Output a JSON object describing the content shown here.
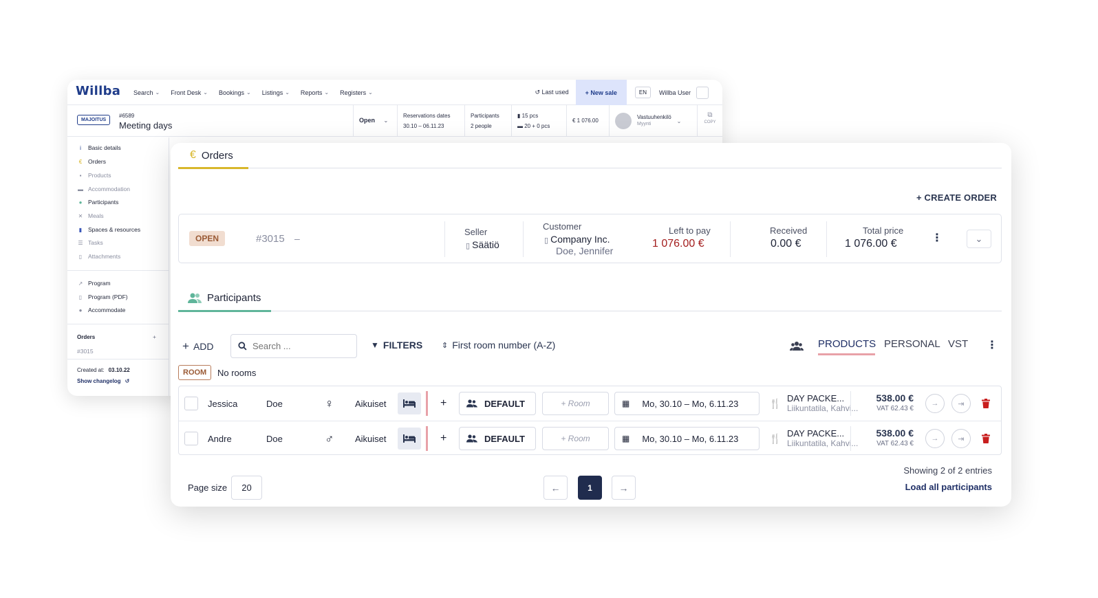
{
  "app": {
    "logo": "Willba"
  },
  "nav": {
    "menu": [
      "Search",
      "Front Desk",
      "Bookings",
      "Listings",
      "Reports",
      "Registers"
    ],
    "last_used": "Last used",
    "new_sale": "+ New sale",
    "lang": "EN",
    "user": "Willba User"
  },
  "reservation": {
    "tag": "MAJOITUS",
    "number": "#6589",
    "title": "Meeting days",
    "status": "Open",
    "dates_label": "Reservations dates",
    "dates_value": "30.10 – 06.11.23",
    "participants_label": "Participants",
    "participants_value": "2 people",
    "rooms_pcs": "15 pcs",
    "beds_pcs": "20 + 0 pcs",
    "price": "€ 1 076.00",
    "owner_name": "Vastuuhenkilö",
    "owner_role": "Myynti",
    "copy_label": "COPY"
  },
  "sidebar": {
    "items": [
      {
        "label": "Basic details",
        "icon": "i"
      },
      {
        "label": "Orders",
        "icon": "€"
      },
      {
        "label": "Products",
        "icon": "▪"
      },
      {
        "label": "Accommodation",
        "icon": "▬"
      },
      {
        "label": "Participants",
        "icon": "●"
      },
      {
        "label": "Meals",
        "icon": "✕"
      },
      {
        "label": "Spaces & resources",
        "icon": "▮"
      },
      {
        "label": "Tasks",
        "icon": "☰"
      },
      {
        "label": "Attachments",
        "icon": "▯"
      }
    ],
    "links": [
      {
        "label": "Program",
        "icon": "↗"
      },
      {
        "label": "Program (PDF)",
        "icon": "▯"
      },
      {
        "label": "Accommodate",
        "icon": "●"
      }
    ],
    "orders_title": "Orders",
    "orders_add": "+",
    "orders_item": "#3015",
    "created_label": "Created at:",
    "created_value": "03.10.22",
    "changelog": "Show changelog"
  },
  "orders_section": {
    "tab_label": "Orders",
    "create_order": "+ CREATE ORDER",
    "order": {
      "status": "OPEN",
      "id": "#3015",
      "dash": "–",
      "seller_label": "Seller",
      "seller_value": "Säätiö",
      "customer_label": "Customer",
      "customer_company": "Company Inc.",
      "customer_person": "Doe, Jennifer",
      "left_label": "Left to pay",
      "left_value": "1 076.00 €",
      "received_label": "Received",
      "received_value": "0.00 €",
      "total_label": "Total price",
      "total_value": "1 076.00 €"
    }
  },
  "participants_section": {
    "tab_label": "Participants",
    "add_label": "ADD",
    "search_placeholder": "Search ...",
    "filters_label": "FILTERS",
    "sort_label": "First room number (A-Z)",
    "views": [
      "PRODUCTS",
      "PERSONAL",
      "VST"
    ],
    "room_tag": "ROOM",
    "no_rooms": "No rooms",
    "rows": [
      {
        "first": "Jessica",
        "last": "Doe",
        "gender": "♀",
        "group": "Aikuiset",
        "plus": "+",
        "profile": "DEFAULT",
        "room": "+ Room",
        "dates": "Mo, 30.10 – Mo, 6.11.23",
        "package": "DAY PACKE...",
        "package_sub": "Liikuntatila, Kahvi...",
        "price": "538.00 €",
        "vat": "VAT 62.43 €"
      },
      {
        "first": "Andre",
        "last": "Doe",
        "gender": "♂",
        "group": "Aikuiset",
        "plus": "+",
        "profile": "DEFAULT",
        "room": "+ Room",
        "dates": "Mo, 30.10 – Mo, 6.11.23",
        "package": "DAY PACKE...",
        "package_sub": "Liikuntatila, Kahvi...",
        "price": "538.00 €",
        "vat": "VAT 62.43 €"
      }
    ],
    "page_size_label": "Page size",
    "page_size_value": "20",
    "current_page": "1",
    "showing": "Showing 2 of 2 entries",
    "load_all": "Load all participants"
  },
  "colors": {
    "brand": "#1f3c8a",
    "orders_accent": "#d8b72a",
    "participants_accent": "#5fb59a",
    "danger": "#c81e1e",
    "open_badge": "#f1ddd0"
  }
}
